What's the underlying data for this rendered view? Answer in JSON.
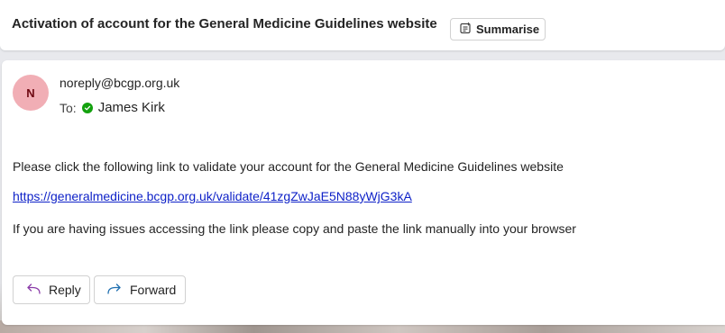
{
  "subject": "Activation of account for the General Medicine Guidelines website",
  "summarise_label": "Summarise",
  "sender": {
    "avatar_initial": "N",
    "email": "noreply@bcgp.org.uk",
    "avatar_color": "#f1aeb5"
  },
  "recipient": {
    "to_label": "To:",
    "name": "James Kirk",
    "presence_color": "#13a10e"
  },
  "body": {
    "line1": "Please click the following link to validate your account for the General Medicine Guidelines website",
    "link": "https://generalmedicine.bcgp.org.uk/validate/41zgZwJaE5N88yWjG3kA",
    "line3": "If you are having issues accessing the link please copy and paste the link manually into your browser"
  },
  "actions": {
    "reply_label": "Reply",
    "forward_label": "Forward"
  },
  "icons": {
    "summarise": "summarise-icon",
    "reply": "reply-icon",
    "forward": "forward-icon",
    "presence": "available-check-icon"
  }
}
